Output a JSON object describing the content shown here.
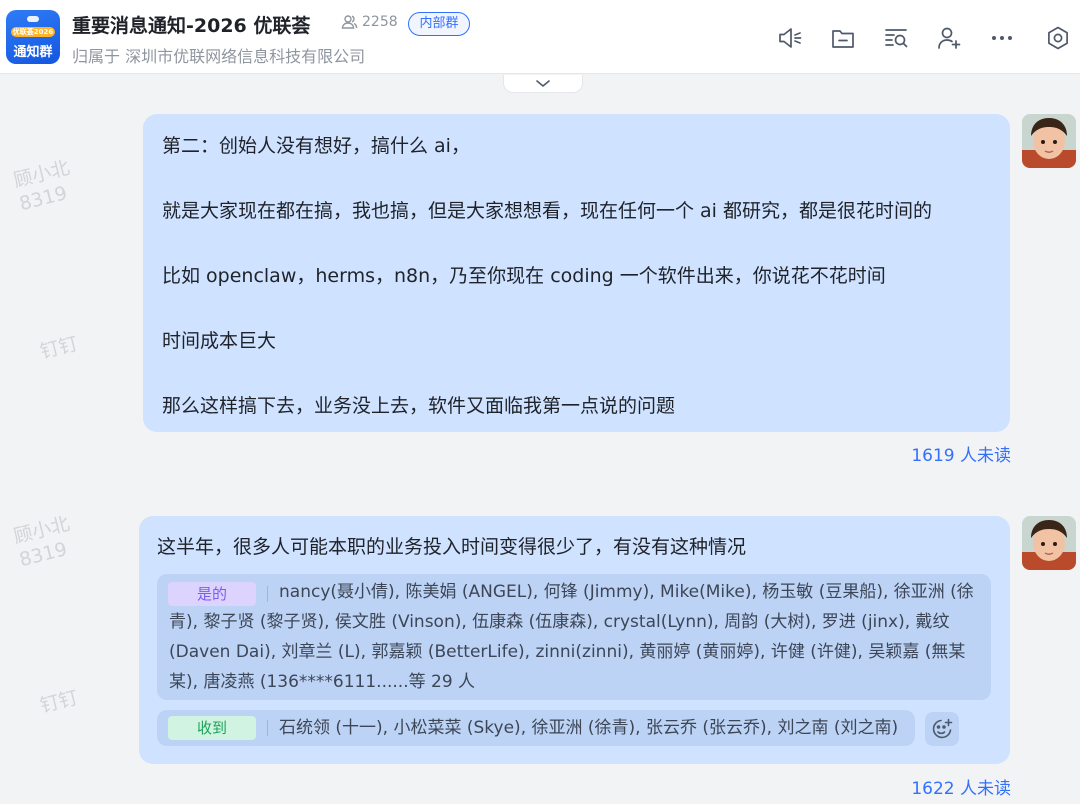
{
  "header": {
    "group_avatar": {
      "year_text": "优联荟2026",
      "main_text": "通知群"
    },
    "title": "重要消息通知-2026 优联荟",
    "member_count": "2258",
    "badge": "内部群",
    "owner": "归属于 深圳市优联网络信息科技有限公司",
    "toolbar_icons": [
      "announcement-icon",
      "folder-icon",
      "search-history-icon",
      "add-member-icon",
      "more-icon",
      "settings-icon"
    ]
  },
  "watermarks": {
    "name": "顾小北\n8319",
    "app": "钉钉"
  },
  "messages": [
    {
      "lines": [
        "第二：创始人没有想好，搞什么 ai，",
        "",
        "就是大家现在都在搞，我也搞，但是大家想想看，现在任何一个 ai 都研究，都是很花时间的",
        "",
        "比如 openclaw，herms，n8n，乃至你现在 coding 一个软件出来，你说花不花时间",
        "",
        "时间成本巨大",
        "",
        "那么这样搞下去，业务没上去，软件又面临我第一点说的问题"
      ],
      "unread": "1619 人未读"
    },
    {
      "question": "这半年，很多人可能本职的业务投入时间变得很少了，有没有这种情况",
      "vote_option": "是的",
      "vote_names": "nancy(聂小倩), 陈美娟 (ANGEL), 何锋 (Jimmy), Mike(Mike), 杨玉敏 (豆果船), 徐亚洲 (徐青), 黎子贤 (黎子贤), 侯文胜 (Vinson), 伍康森 (伍康森), crystal(Lynn), 周韵 (大树), 罗进 (jinx), 戴纹 (Daven Dai), 刘章兰 (L), 郭嘉颖 (BetterLife), zinni(zinni), 黄丽婷 (黄丽婷), 许健 (许健), 吴颖嘉 (無某某), 唐凌燕 (136****6111......等 29 人",
      "received_label": "收到",
      "received_names": "石统领 (十一), 小松菜菜 (Skye), 徐亚洲 (徐青), 张云乔 (张云乔), 刘之南 (刘之南)",
      "unread": "1622 人未读"
    }
  ],
  "colors": {
    "accent": "#3370ff",
    "bubble": "#cfe2ff",
    "vote_chip": "#dcd3ff",
    "received_chip": "#d1f4e2"
  }
}
